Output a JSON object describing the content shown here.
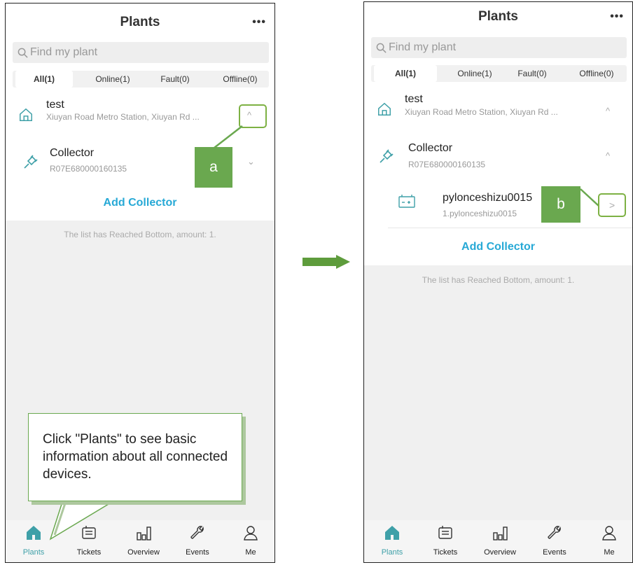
{
  "screens": [
    {
      "title": "Plants",
      "more": "•••",
      "search_placeholder": "Find my plant",
      "filters": [
        "All(1)",
        "Online(1)",
        "Fault(0)",
        "Offline(0)"
      ],
      "plant": {
        "name": "test",
        "address": "Xiuyan Road Metro Station, Xiuyan Rd ...",
        "toggle": "^"
      },
      "collector": {
        "name": "Collector",
        "serial": "R07E680000160135",
        "toggle": "⌄"
      },
      "add_collector": "Add Collector",
      "reached_bottom": "The list has Reached Bottom, amount: 1.",
      "marker_label": "a"
    },
    {
      "title": "Plants",
      "more": "•••",
      "search_placeholder": "Find my plant",
      "filters": [
        "All(1)",
        "Online(1)",
        "Fault(0)",
        "Offline(0)"
      ],
      "plant": {
        "name": "test",
        "address": "Xiuyan Road Metro Station, Xiuyan Rd ...",
        "toggle": "^"
      },
      "collector": {
        "name": "Collector",
        "serial": "R07E680000160135",
        "toggle": "^"
      },
      "device": {
        "name": "pylonceshizu0015",
        "sub": "1.pylonceshizu0015",
        "chevron": ">"
      },
      "add_collector": "Add Collector",
      "reached_bottom": "The list has Reached Bottom, amount: 1.",
      "marker_label": "b"
    }
  ],
  "tabbar": [
    "Plants",
    "Tickets",
    "Overview",
    "Events",
    "Me"
  ],
  "callout": "Click \"Plants\" to see basic information about all connected devices.",
  "colors": {
    "accent": "#27a9d6",
    "annotation_green": "#6aa84f",
    "icon_green": "#3fa0a8",
    "arrow": "#5e9c3c"
  }
}
